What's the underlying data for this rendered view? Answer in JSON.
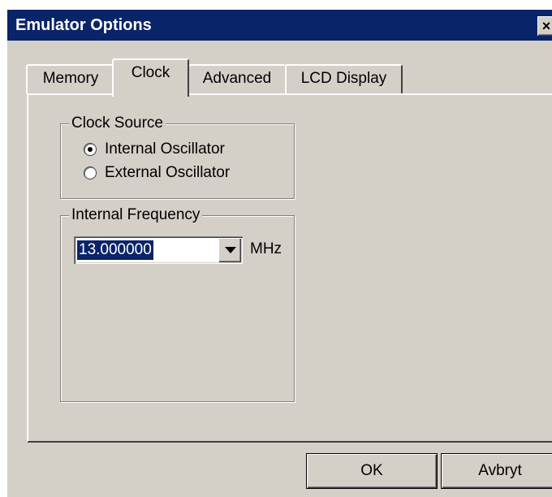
{
  "window": {
    "title": "Emulator Options",
    "close_glyph": "×"
  },
  "tabs": [
    {
      "label": "Memory",
      "selected": false
    },
    {
      "label": "Clock",
      "selected": true
    },
    {
      "label": "Advanced",
      "selected": false
    },
    {
      "label": "LCD Display",
      "selected": false
    }
  ],
  "clock_source": {
    "legend": "Clock Source",
    "options": [
      {
        "label": "Internal Oscillator",
        "checked": true
      },
      {
        "label": "External Oscillator",
        "checked": false
      }
    ]
  },
  "internal_frequency": {
    "legend": "Internal Frequency",
    "value": "13.000000",
    "unit": "MHz"
  },
  "buttons": {
    "ok": "OK",
    "cancel": "Avbryt"
  },
  "colors": {
    "face": "#d4d0c8",
    "titlebar": "#0a246a",
    "selection": "#0a246a"
  },
  "icons": {
    "close": "close-icon",
    "dropdown": "chevron-down-icon"
  }
}
